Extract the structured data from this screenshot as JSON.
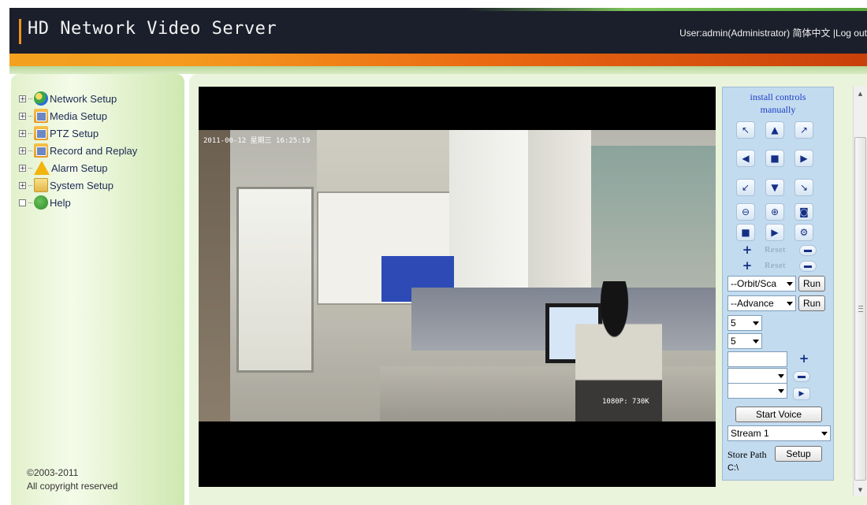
{
  "header": {
    "title": "HD Network Video Server",
    "user": "User:admin(Administrator)",
    "language": "简体中文",
    "separator": "|",
    "logout": "Log out"
  },
  "sidebar": {
    "items": [
      {
        "label": "Network Setup",
        "icon": "globe-icon"
      },
      {
        "label": "Media Setup",
        "icon": "folder-icon"
      },
      {
        "label": "PTZ Setup",
        "icon": "folder-icon"
      },
      {
        "label": "Record and Replay",
        "icon": "folder-icon"
      },
      {
        "label": "Alarm Setup",
        "icon": "warning-icon"
      },
      {
        "label": "System Setup",
        "icon": "system-icon"
      },
      {
        "label": "Help",
        "icon": "help-icon"
      }
    ],
    "expander_symbol": "+",
    "copyright_line1": "©2003-2011",
    "copyright_line2": "All copyright reserved"
  },
  "video": {
    "osd_timestamp": "2011-00-12 星期三 16:25:19",
    "osd_resolution": "1080P: 730K"
  },
  "controls": {
    "install_line1": "install controls",
    "install_line2": "manually",
    "reset_label": "Reset",
    "orbit_select": "--Orbit/Sca",
    "advance_select": "--Advance",
    "run_label": "Run",
    "speed_select_1": "5",
    "speed_select_2": "5",
    "start_voice": "Start Voice",
    "stream_select": "Stream 1",
    "store_path_label": "Store Path",
    "setup_label": "Setup",
    "store_path_value": "C:\\"
  },
  "colors": {
    "header_bg": "#1b1f2b",
    "accent_orange": "#f39019",
    "link_blue": "#1a3ec7",
    "panel_green": "#eaf4dc"
  }
}
